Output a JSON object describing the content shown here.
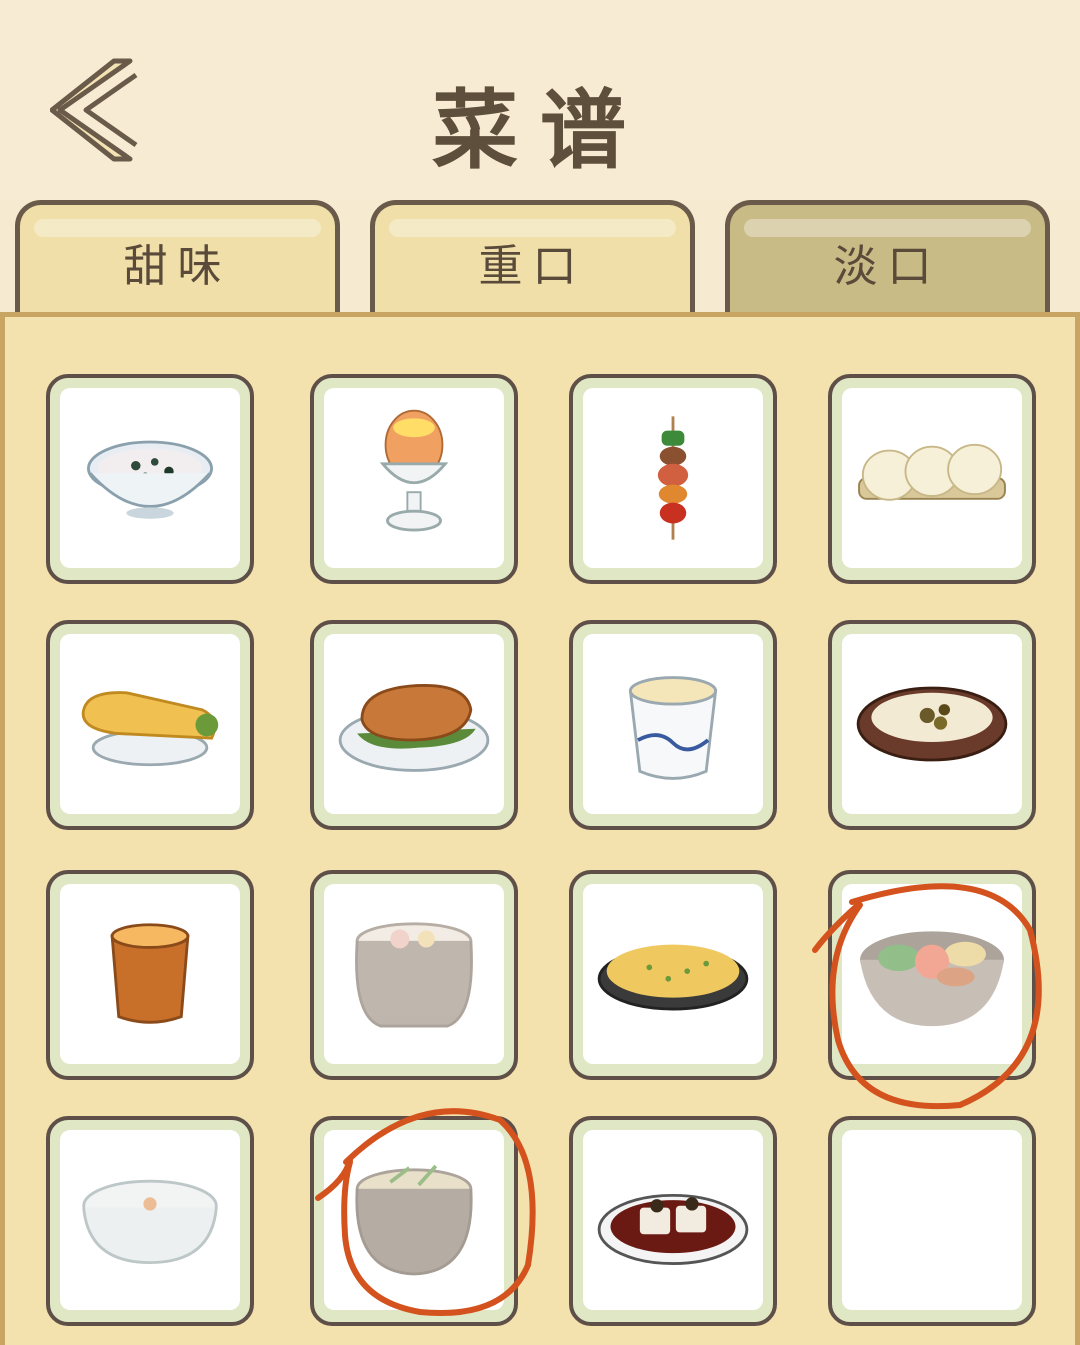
{
  "header": {
    "title": "菜谱",
    "back_icon": "chevron-left-icon"
  },
  "tabs": [
    {
      "label": "甜味",
      "active": false
    },
    {
      "label": "重口",
      "active": false
    },
    {
      "label": "淡口",
      "active": true
    }
  ],
  "recipes": [
    {
      "icon": "porridge-bowl-icon",
      "unlocked": true
    },
    {
      "icon": "boiled-egg-cup-icon",
      "unlocked": true
    },
    {
      "icon": "vegetable-skewer-icon",
      "unlocked": true
    },
    {
      "icon": "steamed-buns-plate-icon",
      "unlocked": true
    },
    {
      "icon": "egg-crepe-roll-icon",
      "unlocked": true
    },
    {
      "icon": "roast-duck-plate-icon",
      "unlocked": true
    },
    {
      "icon": "soy-milk-cup-icon",
      "unlocked": true
    },
    {
      "icon": "mushroom-soup-bowl-icon",
      "unlocked": true
    },
    {
      "icon": "milk-tea-cup-icon",
      "unlocked": true
    },
    {
      "icon": "chicken-soup-pot-icon",
      "unlocked": false
    },
    {
      "icon": "fried-rice-plate-icon",
      "unlocked": true
    },
    {
      "icon": "bibimbap-bowl-icon",
      "unlocked": false
    },
    {
      "icon": "vegetable-casserole-icon",
      "unlocked": false
    },
    {
      "icon": "hot-pot-stew-icon",
      "unlocked": false
    },
    {
      "icon": "mapo-tofu-plate-icon",
      "unlocked": true
    },
    {
      "icon": "empty-slot",
      "unlocked": false
    }
  ],
  "colors": {
    "background": "#f7ecd3",
    "panel": "#f3e2ad",
    "tab_active": "#c9bb86",
    "tab_inactive": "#f0dfa8",
    "annotation": "#d4521e"
  }
}
